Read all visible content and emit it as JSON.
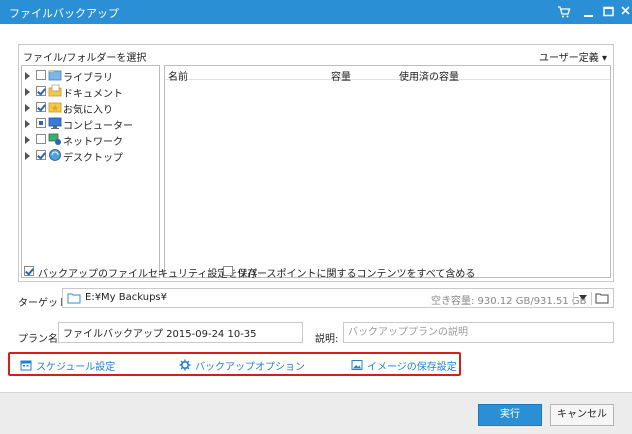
{
  "window": {
    "title": "ファイルバックアップ"
  },
  "source": {
    "title": "ファイル/フォルダーを選択",
    "user_defined": "ユーザー定義 ▾",
    "tree": [
      {
        "label": "ライブラリ",
        "checked": false,
        "icon": "library-icon"
      },
      {
        "label": "ドキュメント",
        "checked": true,
        "icon": "documents-icon"
      },
      {
        "label": "お気に入り",
        "checked": true,
        "icon": "favorites-icon"
      },
      {
        "label": "コンピューター",
        "checked": "partial",
        "icon": "computer-icon"
      },
      {
        "label": "ネットワーク",
        "checked": false,
        "icon": "network-icon"
      },
      {
        "label": "デスクトップ",
        "checked": true,
        "icon": "desktop-icon"
      }
    ],
    "columns": [
      "名前",
      "容量",
      "使用済の容量"
    ]
  },
  "options": {
    "save_security": {
      "label": "バックアップのファイルセキュリティ設定を保存",
      "checked": true
    },
    "include_restore": {
      "label": "リパースポイントに関するコンテンツをすべて含める",
      "checked": false
    }
  },
  "target": {
    "label": "ターゲット:",
    "path": "E:¥My Backups¥",
    "free_space": "空き容量: 930.12 GB/931.51 GB"
  },
  "plan": {
    "label": "プラン名:",
    "value": "ファイルバックアップ 2015-09-24 10-35",
    "desc_label": "説明:",
    "desc_placeholder": "バックアッププランの説明"
  },
  "links": {
    "schedule": "スケジュール設定",
    "backup_options": "バックアップオプション",
    "image_storage": "イメージの保存設定"
  },
  "footer": {
    "run": "実行",
    "cancel": "キャンセル"
  },
  "colors": {
    "accent": "#2b8fd6",
    "link": "#1f7fd1",
    "highlight_border": "#d41f1f"
  }
}
